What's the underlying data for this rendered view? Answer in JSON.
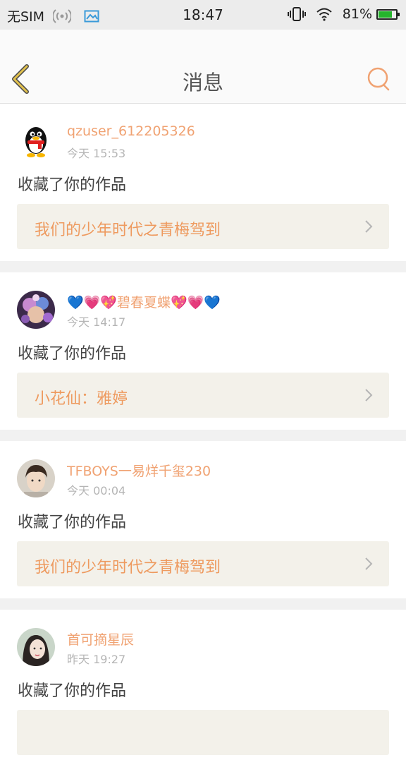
{
  "status_bar": {
    "carrier": "无SIM",
    "time": "18:47",
    "battery": "81%",
    "battery_level": 0.81,
    "battery_color": "#25b52c",
    "icons": [
      "wifi-hotspot-icon",
      "image-icon",
      "vibrate-icon",
      "wifi-icon",
      "battery-icon"
    ]
  },
  "header": {
    "title": "消息",
    "back_icon": "chevron-left-icon",
    "search_icon": "search-icon",
    "accent": "#f0a272"
  },
  "messages": [
    {
      "username": "qzuser_612205326",
      "time": "今天 15:53",
      "action": "收藏了你的作品",
      "work": "我们的少年时代之青梅驾到",
      "avatar": "qq-penguin-icon"
    },
    {
      "username": "💙💗💖碧春夏蝶💖💗💙",
      "time": "今天 14:17",
      "action": "收藏了你的作品",
      "work": "小花仙：雅婷",
      "avatar": "anime-avatar"
    },
    {
      "username": "TFBOYS一易烊千玺230",
      "time": "今天 00:04",
      "action": "收藏了你的作品",
      "work": "我们的少年时代之青梅驾到",
      "avatar": "photo-avatar"
    },
    {
      "username": "首可摘星辰",
      "time": "昨天 19:27",
      "action": "收藏了你的作品",
      "work": "",
      "avatar": "photo-avatar"
    }
  ]
}
